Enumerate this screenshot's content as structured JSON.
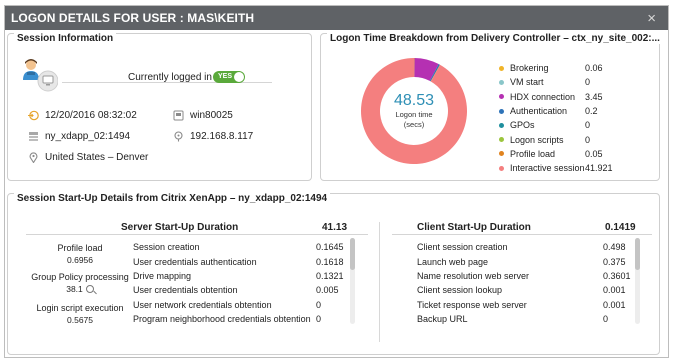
{
  "dialog": {
    "title": "LOGON DETAILS FOR USER : MAS\\KEITH",
    "close_glyph": "×"
  },
  "session_info": {
    "title": "Session Information",
    "status_label": "Currently logged in",
    "status_toggle": "YES",
    "logon_time": "12/20/2016 08:32:02",
    "machine": "win80025",
    "delivery_group": "ny_xdapp_02:1494",
    "client_ip": "192.168.8.117",
    "location": "United States – Denver",
    "icons": [
      "user-avatar-icon",
      "monitor-icon",
      "clock-login-icon",
      "computer-icon",
      "server-icon",
      "network-icon",
      "location-pin-icon"
    ]
  },
  "logon_breakdown": {
    "title": "Logon Time Breakdown from Delivery Controller – ctx_ny_site_002:...",
    "total_value": "48.53",
    "total_label": "Logon time",
    "total_unit": "(secs)",
    "items": [
      {
        "label": "Brokering",
        "value": "0.06",
        "color": "#f0b429"
      },
      {
        "label": "VM start",
        "value": "0",
        "color": "#8ac6c9"
      },
      {
        "label": "HDX connection",
        "value": "3.45",
        "color": "#b530b2"
      },
      {
        "label": "Authentication",
        "value": "0.2",
        "color": "#2e73b8"
      },
      {
        "label": "GPOs",
        "value": "0",
        "color": "#1f8f9e"
      },
      {
        "label": "Logon scripts",
        "value": "0",
        "color": "#9bc53d"
      },
      {
        "label": "Profile load",
        "value": "0.05",
        "color": "#e0831f"
      },
      {
        "label": "Interactive session",
        "value": "41.921",
        "color": "#f47f7f"
      }
    ]
  },
  "startup": {
    "title": "Session Start-Up Details from Citrix XenApp – ny_xdapp_02:1494",
    "server": {
      "heading": "Server Start-Up Duration",
      "total": "41.13",
      "metrics": [
        {
          "label": "Profile load",
          "value": "0.6956"
        },
        {
          "label": "Group Policy processing",
          "value": "38.1"
        },
        {
          "label": "Login script execution",
          "value": "0.5675"
        }
      ],
      "rows": [
        {
          "name": "Session creation",
          "value": "0.1645"
        },
        {
          "name": "User credentials authentication",
          "value": "0.1618"
        },
        {
          "name": "Drive mapping",
          "value": "0.1321"
        },
        {
          "name": "User credentials obtention",
          "value": "0.005"
        },
        {
          "name": "User network credentials obtention",
          "value": "0"
        },
        {
          "name": "Program neighborhood credentials obtention",
          "value": "0"
        }
      ]
    },
    "client": {
      "heading": "Client Start-Up Duration",
      "total": "0.1419",
      "rows": [
        {
          "name": "Client session creation",
          "value": "0.498"
        },
        {
          "name": "Launch web page",
          "value": "0.375"
        },
        {
          "name": "Name resolution web server",
          "value": "0.3601"
        },
        {
          "name": "Client session lookup",
          "value": "0.001"
        },
        {
          "name": "Ticket response web server",
          "value": "0.001"
        },
        {
          "name": "Backup URL",
          "value": "0"
        }
      ]
    }
  }
}
